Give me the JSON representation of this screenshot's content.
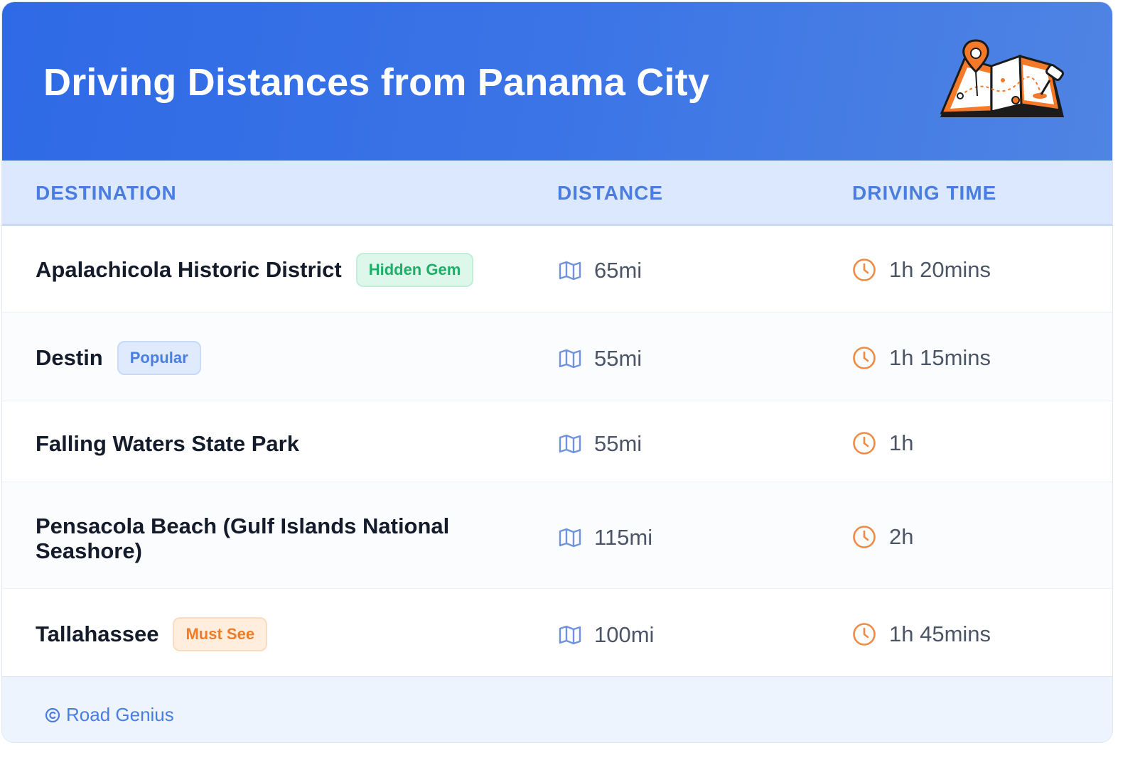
{
  "header": {
    "title": "Driving Distances from Panama City",
    "illustration_icon": "map-with-pins-icon"
  },
  "table": {
    "columns": [
      "DESTINATION",
      "DISTANCE",
      "DRIVING TIME"
    ],
    "rows": [
      {
        "destination": "Apalachicola Historic District",
        "badge": "Hidden Gem",
        "badge_color": "#1fae68",
        "distance": "65mi",
        "time": "1h 20mins"
      },
      {
        "destination": "Destin",
        "badge": "Popular",
        "badge_color": "#4a7ee0",
        "distance": "55mi",
        "time": "1h 15mins"
      },
      {
        "destination": "Falling Waters State Park",
        "badge": "",
        "distance": "55mi",
        "time": "1h"
      },
      {
        "destination": "Pensacola Beach (Gulf Islands National Seashore)",
        "badge": "",
        "distance": "115mi",
        "time": "2h"
      },
      {
        "destination": "Tallahassee",
        "badge": "Must See",
        "badge_color": "#f07c25",
        "distance": "100mi",
        "time": "1h 45mins"
      }
    ],
    "distance_icon": "map-icon",
    "time_icon": "clock-icon"
  },
  "footer": {
    "brand": "Road Genius",
    "icon": "copyright-icon"
  },
  "colors": {
    "header_blue": "#2f6ae6",
    "accent_blue": "#4a7de0",
    "clock_orange": "#f08a45"
  }
}
